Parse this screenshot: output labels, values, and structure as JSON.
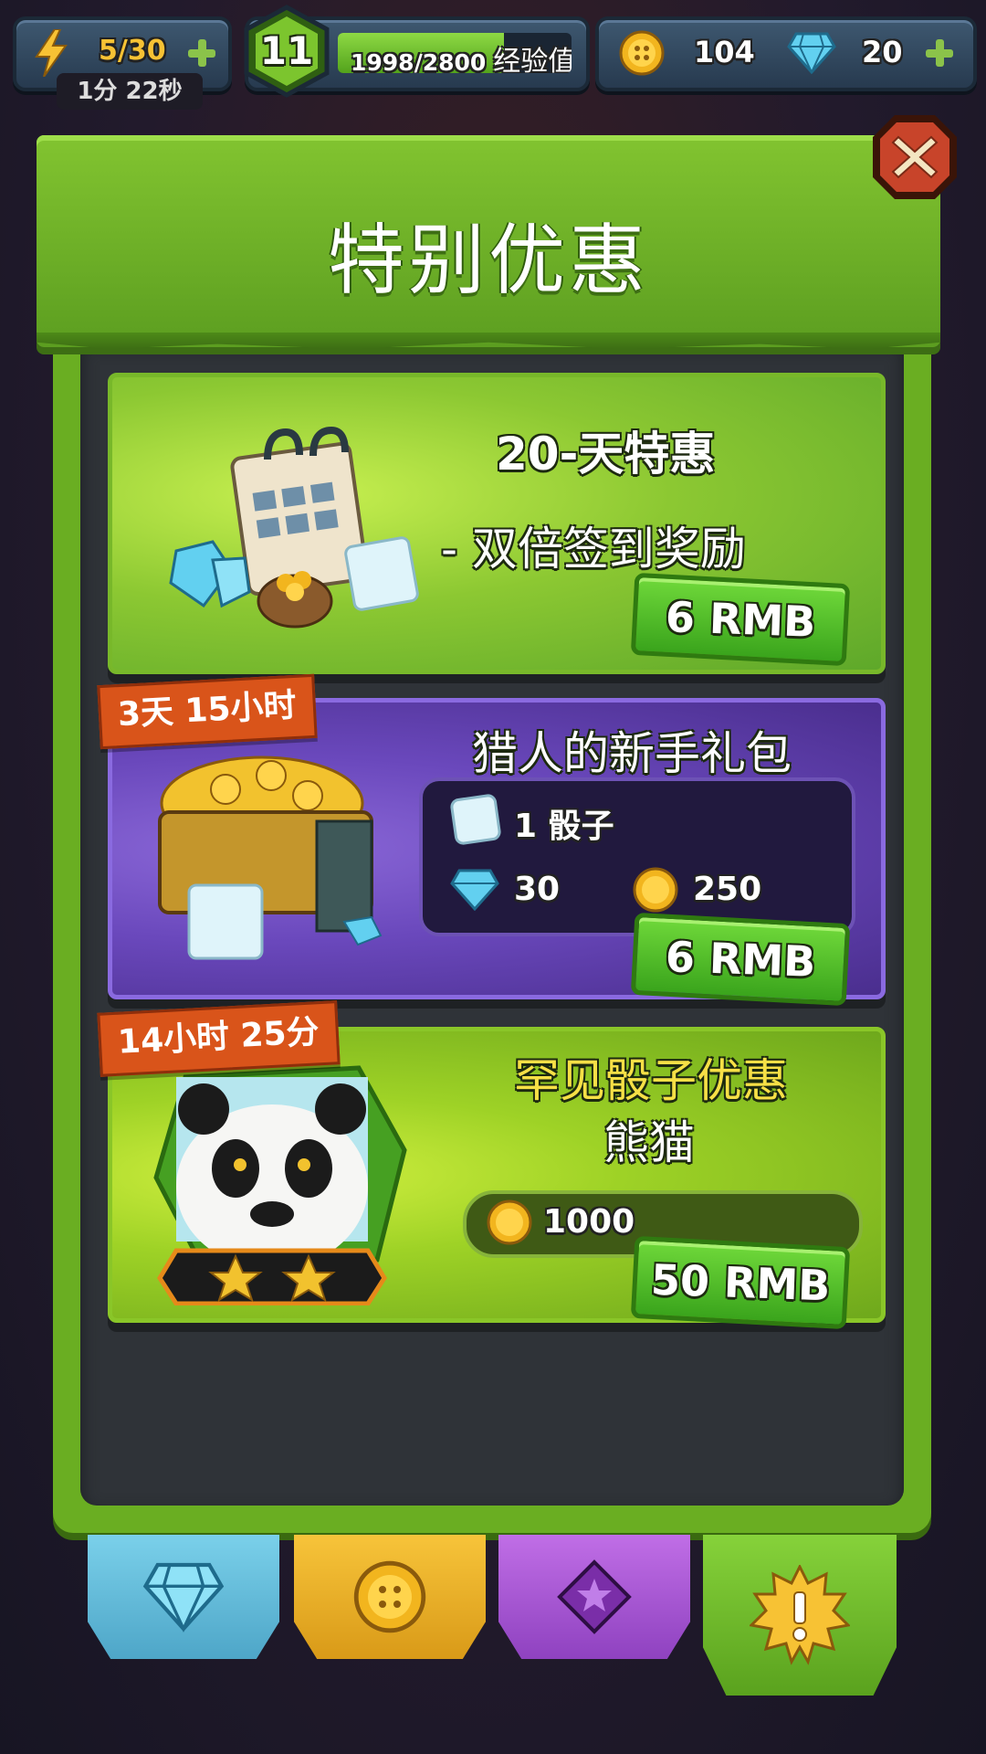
{
  "hud": {
    "energy": "5/30",
    "energy_timer": "1分 22秒",
    "level": "11",
    "xp_text": "1998/2800",
    "xp_label": "经验值",
    "xp_progress": 0.71,
    "coins": "104",
    "gems": "20"
  },
  "dialog": {
    "title": "特别优惠"
  },
  "offers": [
    {
      "title": "20-天特惠",
      "subtitle": "- 双倍签到奖励",
      "price": "6 RMB"
    },
    {
      "timer": "3天 15小时",
      "title": "猎人的新手礼包",
      "dice_reward": "1 骰子",
      "gems_reward": "30",
      "coins_reward": "250",
      "price": "6 RMB"
    },
    {
      "timer": "14小时 25分",
      "title": "罕见骰子优惠",
      "subtitle": "熊猫",
      "coins_reward": "1000",
      "price": "50 RMB"
    }
  ],
  "icons": {
    "energy": "lightning-icon",
    "coin": "coin-icon",
    "gem": "diamond-icon",
    "close": "close-icon",
    "tab_special": "exclamation-starburst-icon",
    "tab_purple": "purple-gem-star-icon"
  },
  "colors": {
    "accent_green": "#6aae22",
    "energy_yellow": "#f7c234",
    "timer_orange": "#d9541a",
    "purple_card": "#6a48bc"
  }
}
